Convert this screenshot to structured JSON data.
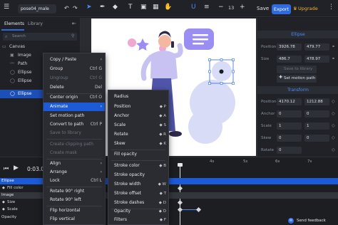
{
  "app": {
    "filename": "pose04_male",
    "save_label": "Save",
    "export_label": "Export",
    "upgrade_label": "Upgrade",
    "zoom": "13",
    "accent": "#2f6ae0",
    "upgrade_color": "#f1b431"
  },
  "left_panel": {
    "tabs": [
      "Elements",
      "Library"
    ],
    "search_placeholder": "Search",
    "layers": [
      {
        "label": "Canvas",
        "icon": "canvas-icon"
      },
      {
        "label": "Image",
        "icon": "image-icon"
      },
      {
        "label": "Path",
        "icon": "path-icon"
      },
      {
        "label": "Ellipse",
        "icon": "ellipse-icon"
      },
      {
        "label": "Ellipse",
        "icon": "ellipse-icon"
      },
      {
        "label": "Ellipse",
        "icon": "ellipse-icon",
        "selected": true
      }
    ]
  },
  "right_panel": {
    "section_title": "Ellipse",
    "position_label": "Position",
    "position_x": "3926.78",
    "position_y": "479.77",
    "size_label": "Size",
    "size_w": "486.7",
    "size_h": "478.97",
    "save_to_library": "Save to library",
    "set_motion_path": "Set motion path",
    "transform_title": "Transform",
    "t_position_label": "Position",
    "t_position_x": "4170.12",
    "t_position_y": "1212.88",
    "anchor_label": "Anchor",
    "anchor_x": "0",
    "anchor_y": "0",
    "scale_label": "Scale",
    "scale_x": "1",
    "scale_y": "1",
    "skew_label": "Skew",
    "skew_x": "0",
    "skew_y": "0",
    "rotate_label": "Rotate",
    "rotate_value": "0"
  },
  "timeline": {
    "time_readout": "0:03.0",
    "ticks": [
      "3s",
      "4s",
      "5s",
      "6s",
      "7s"
    ],
    "rows": [
      {
        "label": "Ellipse",
        "kind": "selected"
      },
      {
        "label": "Fill color",
        "kind": "prop"
      },
      {
        "label": "Image",
        "kind": "group"
      },
      {
        "label": "Size",
        "kind": "prop"
      },
      {
        "label": "Scale",
        "kind": "prop"
      },
      {
        "label": "Opacity",
        "kind": "prop"
      }
    ],
    "send_feedback": "Send feedback"
  },
  "context_menu": {
    "items": [
      {
        "label": "Copy / Paste",
        "shortcut": "›",
        "state": "normal"
      },
      {
        "label": "Group",
        "shortcut": "Ctrl G",
        "state": "normal"
      },
      {
        "label": "Ungroup",
        "shortcut": "Ctrl G",
        "state": "disabled"
      },
      {
        "label": "Delete",
        "shortcut": "Del",
        "state": "normal"
      },
      {
        "label": "Center origin",
        "shortcut": "Ctrl O",
        "state": "normal"
      },
      {
        "label": "Animate",
        "shortcut": "›",
        "state": "highlighted"
      },
      {
        "label": "Set motion path",
        "shortcut": "",
        "state": "normal"
      },
      {
        "label": "Convert to path",
        "shortcut": "Ctrl P",
        "state": "normal"
      },
      {
        "label": "Save to library",
        "shortcut": "",
        "state": "disabled"
      },
      {
        "label": "Create clipping path",
        "shortcut": "",
        "state": "disabled"
      },
      {
        "label": "Create mask",
        "shortcut": "",
        "state": "disabled"
      },
      {
        "label": "Align",
        "shortcut": "›",
        "state": "normal"
      },
      {
        "label": "Arrange",
        "shortcut": "›",
        "state": "normal"
      },
      {
        "label": "Lock",
        "shortcut": "Ctrl L",
        "state": "normal"
      },
      {
        "label": "Rotate 90° right",
        "shortcut": "",
        "state": "normal"
      },
      {
        "label": "Rotate 90° left",
        "shortcut": "",
        "state": "normal"
      },
      {
        "label": "Flip horizontal",
        "shortcut": "",
        "state": "normal"
      },
      {
        "label": "Flip vertical",
        "shortcut": "",
        "state": "normal"
      }
    ]
  },
  "animate_submenu": {
    "items": [
      {
        "label": "Radius",
        "shortcut": ""
      },
      {
        "label": "Position",
        "shortcut": "◆ P"
      },
      {
        "label": "Anchor",
        "shortcut": "◆ A"
      },
      {
        "label": "Scale",
        "shortcut": "◆ S"
      },
      {
        "label": "Rotate",
        "shortcut": "◆ R"
      },
      {
        "label": "Skew",
        "shortcut": "◆ K"
      },
      {
        "label": "Fill opacity",
        "shortcut": ""
      },
      {
        "label": "Stroke color",
        "shortcut": "◆ B"
      },
      {
        "label": "Stroke opacity",
        "shortcut": ""
      },
      {
        "label": "Stroke width",
        "shortcut": "◆ W"
      },
      {
        "label": "Stroke offset",
        "shortcut": "◆ T"
      },
      {
        "label": "Stroke dashes",
        "shortcut": "◆ D"
      },
      {
        "label": "Opacity",
        "shortcut": "◆ O"
      },
      {
        "label": "Filters",
        "shortcut": "◆ F"
      }
    ]
  }
}
